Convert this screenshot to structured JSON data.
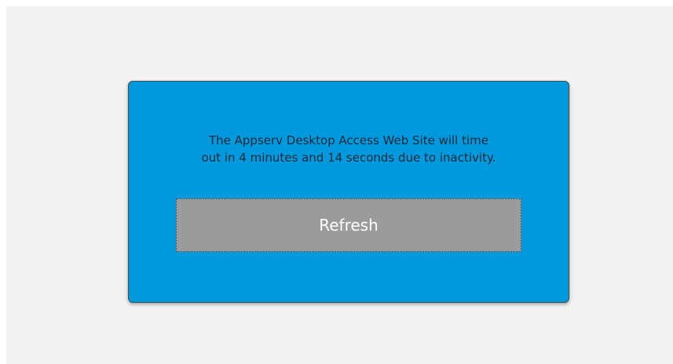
{
  "dialog": {
    "message_line1": "The Appserv Desktop Access Web Site will time",
    "message_line2": "out in 4 minutes and 14 seconds due to inactivity.",
    "refresh_label": "Refresh"
  },
  "colors": {
    "page_background": "#f2f2f2",
    "dialog_background": "#0099dd",
    "button_background": "#9b9b9b",
    "button_text": "#ffffff",
    "message_text": "#0d2a3a"
  }
}
